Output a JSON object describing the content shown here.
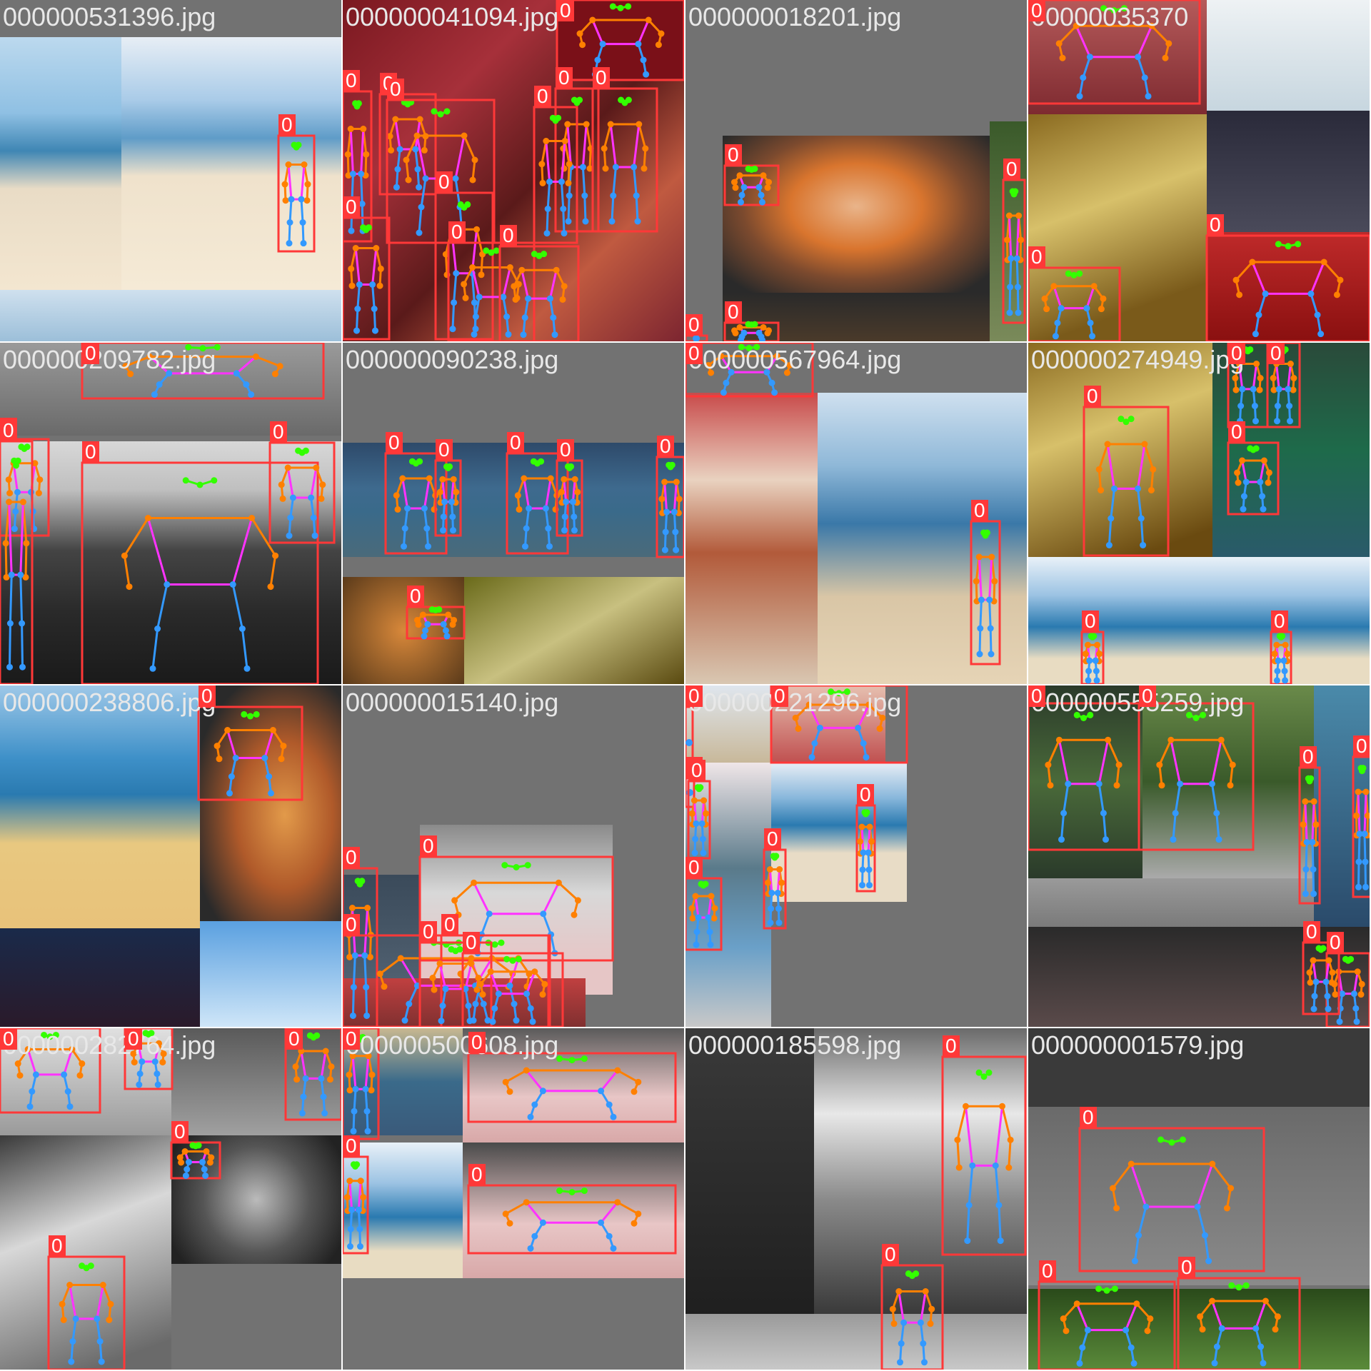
{
  "class_label": "0",
  "colors": {
    "box": "#ff3838",
    "label_bg": "#ff3838",
    "label_text": "#ffffff",
    "kp_face": "#33ff00",
    "kp_arm": "#ff8000",
    "kp_leg": "#3399ff",
    "kp_torso": "#ff33ff",
    "background_gray": "#727272"
  },
  "tiles": [
    {
      "filename": "000000531396.jpg",
      "theme": "beach"
    },
    {
      "filename": "000000041094.jpg",
      "theme": "crowd"
    },
    {
      "filename": "000000018201.jpg",
      "theme": "pizza"
    },
    {
      "filename": "00000035370",
      "theme": "blur"
    },
    {
      "filename": "000000209782.jpg",
      "theme": "bench"
    },
    {
      "filename": "000000090238.jpg",
      "theme": "tennis"
    },
    {
      "filename": "000000567964.jpg",
      "theme": "hotdog"
    },
    {
      "filename": "000000274949.jpg",
      "theme": "umbrella"
    },
    {
      "filename": "000000238806.jpg",
      "theme": "beachpizza"
    },
    {
      "filename": "000000015140.jpg",
      "theme": "sleep"
    },
    {
      "filename": "000000221296.jpg",
      "theme": "beachsmall"
    },
    {
      "filename": "000000555259.jpg",
      "theme": "park"
    },
    {
      "filename": "000000282764.jpg",
      "theme": "bw"
    },
    {
      "filename": "000000500608.jpg",
      "theme": "shoes"
    },
    {
      "filename": "000000185598.jpg",
      "theme": "surf"
    },
    {
      "filename": "000000001579.jpg",
      "theme": "tie"
    }
  ]
}
